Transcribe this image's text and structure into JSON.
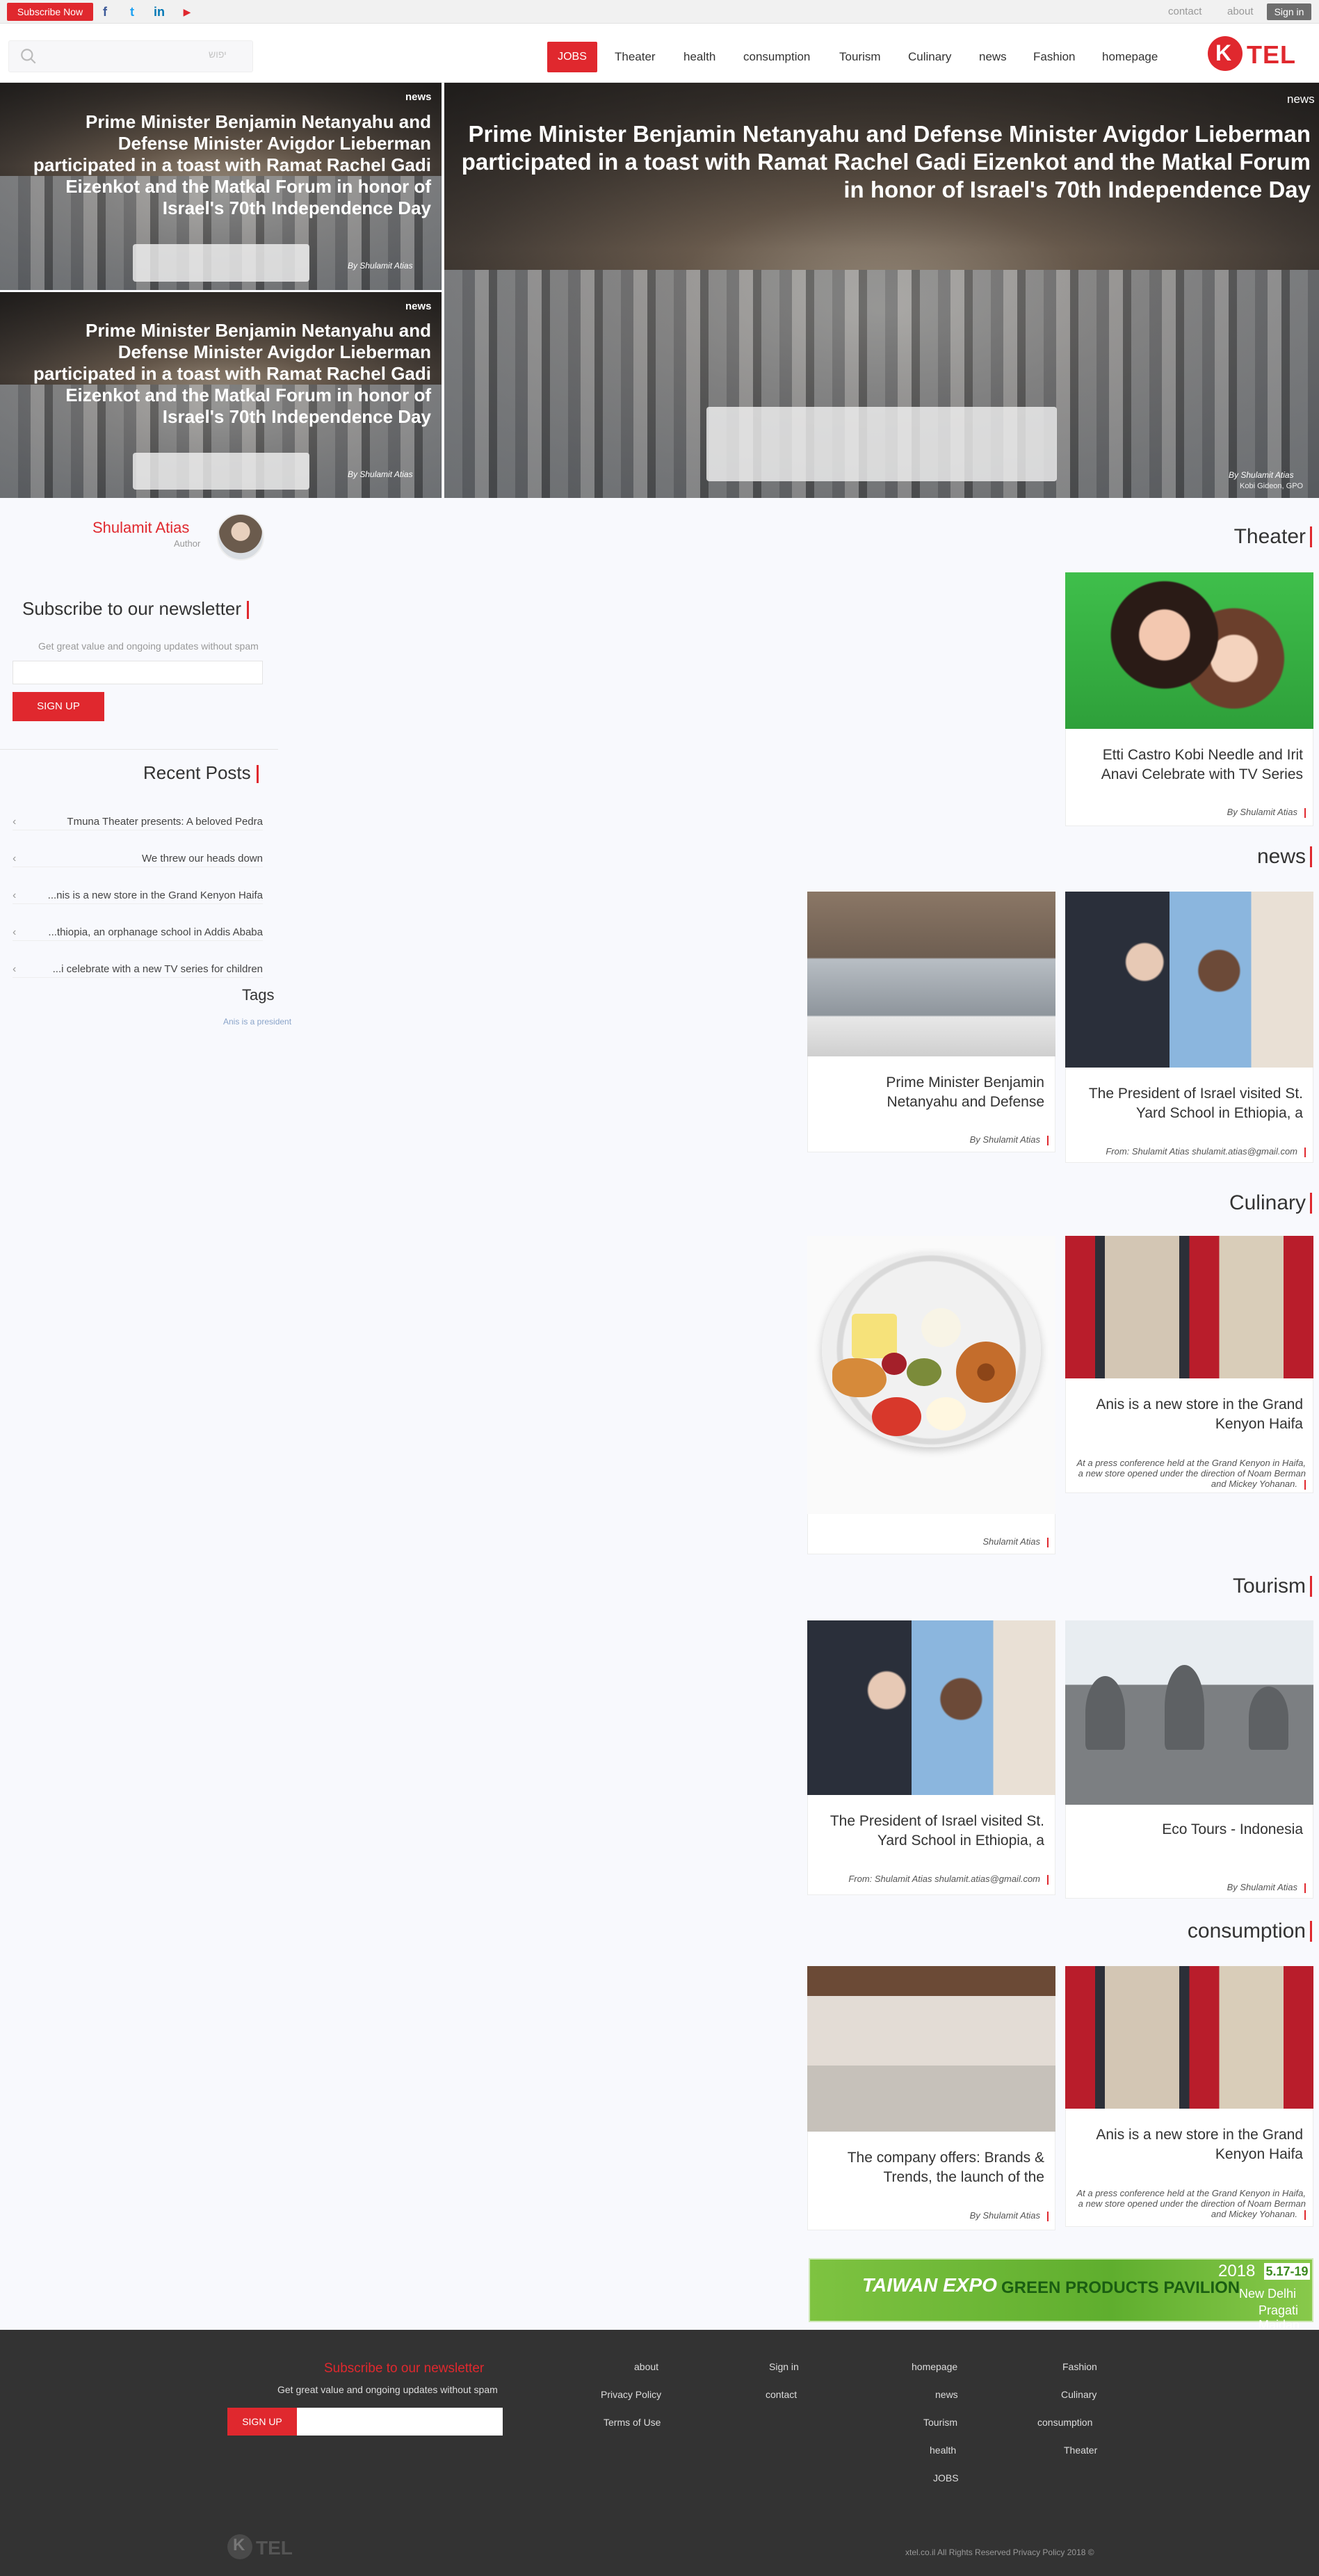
{
  "topbar": {
    "subscribe": "Subscribe Now",
    "social": [
      "f",
      "t",
      "in",
      "▶"
    ],
    "links": [
      "contact",
      "about"
    ],
    "signin": "Sign in"
  },
  "header": {
    "search_placeholder": "יפוש",
    "nav": [
      "JOBS",
      "Theater",
      "health",
      "consumption",
      "Tourism",
      "Culinary",
      "news",
      "Fashion",
      "homepage"
    ],
    "logo": "TEL"
  },
  "hero": {
    "small": [
      {
        "tag": "news",
        "title": "Prime Minister Benjamin Netanyahu and Defense Minister Avigdor Lieberman participated in a toast with Ramat Rachel Gadi Eizenkot and the Matkal Forum in honor of Israel's 70th Independence Day",
        "by": "By Shulamit Atias"
      },
      {
        "tag": "news",
        "title": "Prime Minister Benjamin Netanyahu and Defense Minister Avigdor Lieberman participated in a toast with Ramat Rachel Gadi Eizenkot and the Matkal Forum in honor of Israel's 70th Independence Day",
        "by": "By Shulamit Atias"
      }
    ],
    "main": {
      "tag": "news",
      "title": "Prime Minister Benjamin Netanyahu and Defense Minister Avigdor Lieberman participated in a toast with Ramat Rachel Gadi Eizenkot and the Matkal Forum in honor of Israel's 70th Independence Day",
      "by": "By Shulamit Atias",
      "credit": "Kobi Gideon, GPO"
    }
  },
  "sidebar": {
    "author_name": "Shulamit Atias",
    "author_role": "Author",
    "newsletter_title": "Subscribe to our newsletter",
    "newsletter_text": "Get great value and ongoing updates without spam",
    "signup": "SIGN UP",
    "recent_title": "Recent Posts",
    "recent": [
      "Tmuna Theater presents: A beloved Pedra",
      "We threw our heads down",
      "...nis is a new store in the Grand Kenyon Haifa",
      "...thiopia, an orphanage school in Addis Ababa",
      "...i celebrate with a new TV series for children"
    ],
    "tags_title": "Tags",
    "tag": "Anis is a president"
  },
  "sections": {
    "theater": {
      "title": "Theater",
      "cards": [
        {
          "title": "Etti Castro Kobi Needle and Irit Anavi Celebrate with TV Series",
          "by": "By Shulamit Atias"
        }
      ]
    },
    "news": {
      "title": "news",
      "cards": [
        {
          "title": "The President of Israel visited St. Yard School in Ethiopia, a",
          "by": "From: Shulamit Atias shulamit.atias@gmail.com"
        },
        {
          "title": "Prime Minister Benjamin Netanyahu and Defense",
          "by": "By Shulamit Atias"
        }
      ]
    },
    "culinary": {
      "title": "Culinary",
      "cards": [
        {
          "title": "Anis is a new store in the Grand Kenyon Haifa",
          "desc": "At a press conference held at the Grand Kenyon in Haifa, a new store opened under the direction of Noam Berman and Mickey Yohanan."
        },
        {
          "by": "Shulamit Atias"
        }
      ]
    },
    "tourism": {
      "title": "Tourism",
      "cards": [
        {
          "title": "Eco Tours - Indonesia",
          "by": "By Shulamit Atias"
        },
        {
          "title": "The President of Israel visited St. Yard School in Ethiopia, a",
          "by": "From: Shulamit Atias shulamit.atias@gmail.com"
        }
      ]
    },
    "consumption": {
      "title": "consumption",
      "cards": [
        {
          "title": "Anis is a new store in the Grand Kenyon Haifa",
          "desc": "At a press conference held at the Grand Kenyon in Haifa, a new store opened under the direction of Noam Berman and Mickey Yohanan."
        },
        {
          "title": "The company offers: Brands & Trends, the launch of the",
          "by": "By Shulamit Atias"
        }
      ]
    }
  },
  "banner": {
    "brand": "TAIWAN EXPO",
    "title": "GREEN PRODUCTS PAVILION",
    "year": "2018",
    "dates": "5.17-19",
    "city": "New Delhi",
    "venue": "Pragati Maidan"
  },
  "footer": {
    "newsletter_title": "Subscribe to our newsletter",
    "newsletter_text": "Get great value and ongoing updates without spam",
    "signup": "SIGN UP",
    "col1": [
      "about",
      "Privacy Policy",
      "Terms of Use"
    ],
    "col2": [
      "Sign in",
      "contact"
    ],
    "col3": [
      "homepage",
      "news",
      "Tourism",
      "health",
      "JOBS"
    ],
    "col4": [
      "Fashion",
      "Culinary",
      "consumption",
      "Theater"
    ],
    "logo": "TEL",
    "copyright": "xtel.co.il All Rights Reserved Privacy Policy 2018 ©"
  },
  "colors": {
    "accent": "#e0282e",
    "footer_bg": "#333333",
    "page_bg": "#f8f9fd"
  }
}
